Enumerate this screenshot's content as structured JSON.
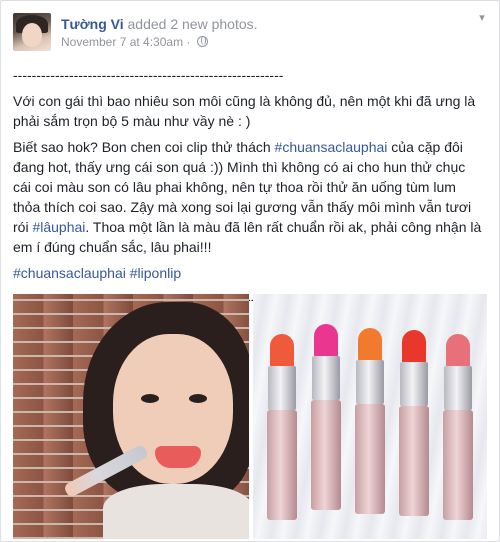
{
  "post": {
    "author": "Tường Vi",
    "action": "added 2 new photos.",
    "timestamp": "November 7 at 4:30am",
    "separator": "·",
    "privacy_icon": "globe-icon",
    "menu_icon": "chevron-down-icon"
  },
  "body": {
    "divider_top": "----------------------------------------------------------",
    "para1": "Với con gái thì bao nhiêu son môi cũng là không đủ, nên một khi đã ưng là phải sắm trọn bộ 5 màu như vầy nè : )",
    "para2_a": "Biết sao hok? Bon chen coi clip thử thách ",
    "para2_tag1": "#chuansaclauphai",
    "para2_b": " của cặp đôi đang hot, thấy ưng cái son quá :)) Mình thì không có ai cho hun thử chục cái coi màu son có lâu phai không, nên tự thoa rồi thử ăn uống tùm lum thỏa thích coi sao. Zậy mà xong soi lại gương vẫn thấy môi mình vẫn tươi rói ",
    "para2_tag2": "#lâuphai",
    "para2_c": ". Thoa một lần là màu đã lên rất chuẩn rồi ak, phải công nhận là em í đúng chuẩn sắc, lâu phai!!!",
    "tag3": "#chuansaclauphai",
    "tag4": "#liponlip",
    "divider_bottom": "----------------------------------------------------------"
  },
  "photos": {
    "left_label": "selfie-photo",
    "right_label": "lipsticks-photo",
    "lipstick_colors": [
      "#ef5a3c",
      "#e9378f",
      "#f07a2e",
      "#e8382b",
      "#e8707b"
    ]
  },
  "colors": {
    "link": "#365899",
    "muted": "#90949c",
    "text": "#1d2129"
  }
}
